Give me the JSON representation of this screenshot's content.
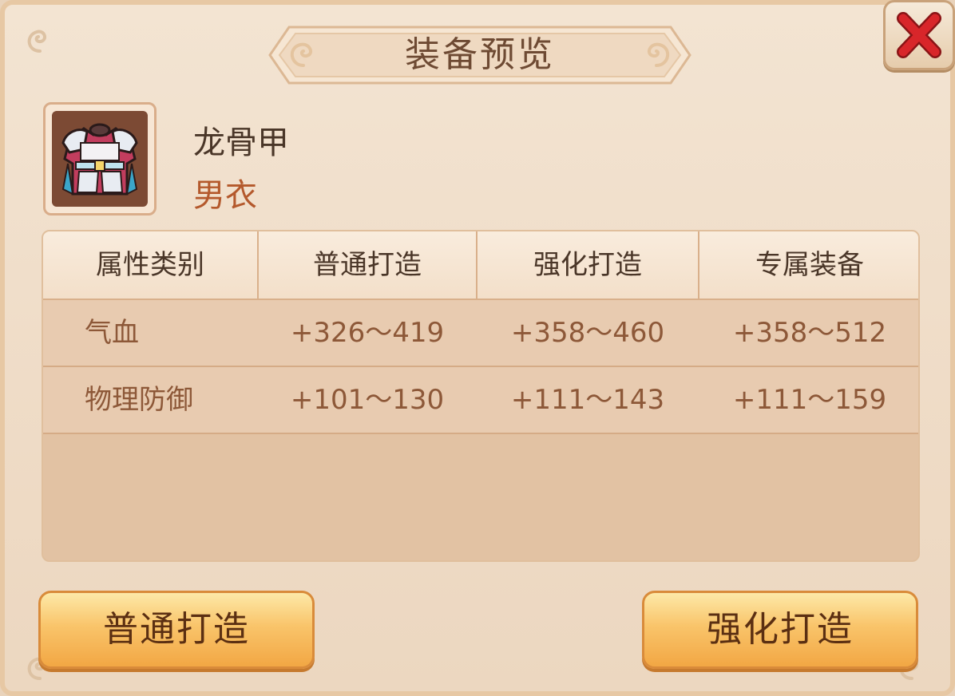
{
  "window": {
    "title": "装备预览"
  },
  "item": {
    "name": "龙骨甲",
    "type": "男衣",
    "icon": "armor-icon"
  },
  "table": {
    "headers": [
      "属性类别",
      "普通打造",
      "强化打造",
      "专属装备"
    ],
    "rows": [
      {
        "label": "气血",
        "normal": "+326～419",
        "enhanced": "+358～460",
        "exclusive": "+358～512"
      },
      {
        "label": "物理防御",
        "normal": "+101～130",
        "enhanced": "+111～143",
        "exclusive": "+111～159"
      }
    ]
  },
  "buttons": {
    "normal_forge": "普通打造",
    "enhanced_forge": "强化打造"
  },
  "colors": {
    "title_text": "#6e4a33",
    "item_type": "#b4592c",
    "close_x": "#d8262a",
    "button_fill": "#f9c46a"
  }
}
